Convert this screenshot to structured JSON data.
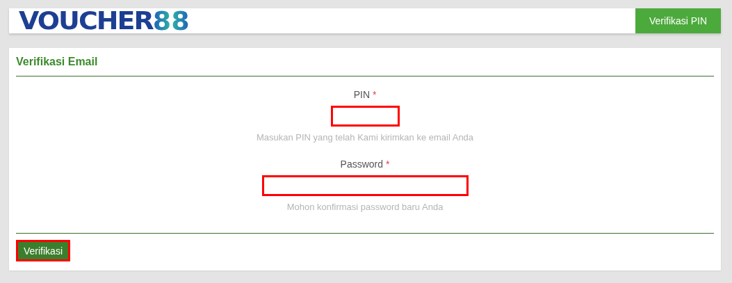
{
  "header": {
    "logo": {
      "word": "VOUCHER",
      "number": "88"
    },
    "action_button": "Verifikasi PIN"
  },
  "card": {
    "title": "Verifikasi Email",
    "fields": [
      {
        "label": "PIN",
        "required_mark": "*",
        "help": "Masukan PIN yang telah Kami kirimkan ke email Anda",
        "kind": "short",
        "highlighted": true
      },
      {
        "label": "Password",
        "required_mark": "*",
        "help": "Mohon konfirmasi password baru Anda",
        "kind": "long",
        "highlighted": true
      }
    ],
    "submit": {
      "label": "Verifikasi",
      "highlighted": true
    }
  }
}
